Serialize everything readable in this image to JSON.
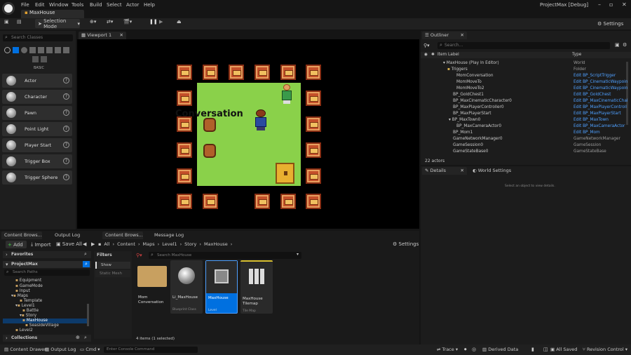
{
  "menu": [
    "File",
    "Edit",
    "Window",
    "Tools",
    "Build",
    "Select",
    "Actor",
    "Help"
  ],
  "tab_label": "MaxHouse",
  "window_title": "ProjectMax [Debug]",
  "toolbar": {
    "mode": "Selection Mode",
    "settings": "Settings"
  },
  "left": {
    "search_placeholder": "Search Classes",
    "category": "BASIC",
    "items": [
      "Actor",
      "Character",
      "Pawn",
      "Point Light",
      "Player Start",
      "Trigger Box",
      "Trigger Sphere"
    ]
  },
  "viewport": {
    "tab": "Viewport 1",
    "overlay_text": "Conversation"
  },
  "outliner": {
    "tab": "Outliner",
    "search_placeholder": "Search...",
    "col_label": "Item Label",
    "col_type": "Type",
    "rows": [
      {
        "label": "MaxHouse (Play In Editor)",
        "type": "World"
      },
      {
        "label": "Triggers",
        "type": "Folder"
      },
      {
        "label": "MomConversation",
        "type": "Edit BP_ScriptTrigger"
      },
      {
        "label": "MomMoveTo",
        "type": "Edit BP_CinematicWaypoin"
      },
      {
        "label": "MomMoveTo2",
        "type": "Edit BP_CinematicWaypoin"
      },
      {
        "label": "BP_GoldChest1",
        "type": "Edit BP_GoldChest"
      },
      {
        "label": "BP_MaxCinematicCharacter0",
        "type": "Edit BP_MaxCinematicChai"
      },
      {
        "label": "BP_MaxPlayerController0",
        "type": "Edit BP_MaxPlayerControll"
      },
      {
        "label": "BP_MaxPlayerStart",
        "type": "Edit BP_MaxPlayerStart"
      },
      {
        "label": "BP_MaxTown0",
        "type": "Edit BP_MaxTown"
      },
      {
        "label": "BP_MaxCameraActor0",
        "type": "Edit BP_MaxCameraActor"
      },
      {
        "label": "BP_Mom1",
        "type": "Edit BP_Mom"
      },
      {
        "label": "GameNetworkManager0",
        "type": "GameNetworkManager"
      },
      {
        "label": "GameSession0",
        "type": "GameSession"
      },
      {
        "label": "GameStateBase0",
        "type": "GameStateBase"
      }
    ],
    "count": "22 actors"
  },
  "details": {
    "tab": "Details",
    "tab2": "World Settings",
    "empty": "Select an object to view details."
  },
  "bottom_tabs": [
    "Content Brows...",
    "Output Log",
    "Content Brows...",
    "Message Log"
  ],
  "content": {
    "add": "Add",
    "import": "Import",
    "save_all": "Save All",
    "breadcrumb": [
      "All",
      "Content",
      "Maps",
      "Level1",
      "Story",
      "MaxHouse"
    ],
    "settings": "Settings",
    "favorites": "Favorites",
    "project": "ProjectMax",
    "search_paths": "Search Paths",
    "tree": [
      "Equipment",
      "GameMode",
      "Input",
      "Maps",
      "Template",
      "Level1",
      "Battle",
      "Story",
      "MaxHouse",
      "SeasideVillage",
      "Level2"
    ],
    "collections": "Collections",
    "filters": "Filters",
    "filter_items": [
      "Show Redirector",
      "Static Mesh"
    ],
    "search_placeholder": "Search MaxHouse",
    "assets": [
      {
        "name": "Mom Conversation",
        "sub": ""
      },
      {
        "name": "Li_MaxHouse",
        "sub": "Blueprint Class"
      },
      {
        "name": "MaxHouse",
        "sub": "Level"
      },
      {
        "name": "MaxHouse Tilemap",
        "sub": "Tile Map"
      }
    ],
    "status": "4 items (1 selected)"
  },
  "statusbar": {
    "drawer": "Content Drawer",
    "output": "Output Log",
    "cmd": "Cmd",
    "console": "Enter Console Command",
    "trace": "Trace",
    "derived": "Derived Data",
    "saved": "All Saved",
    "revision": "Revision Control"
  },
  "colors": {
    "accent": "#0070e0",
    "link": "#4fa0ff",
    "floor": "#8ad14a"
  }
}
